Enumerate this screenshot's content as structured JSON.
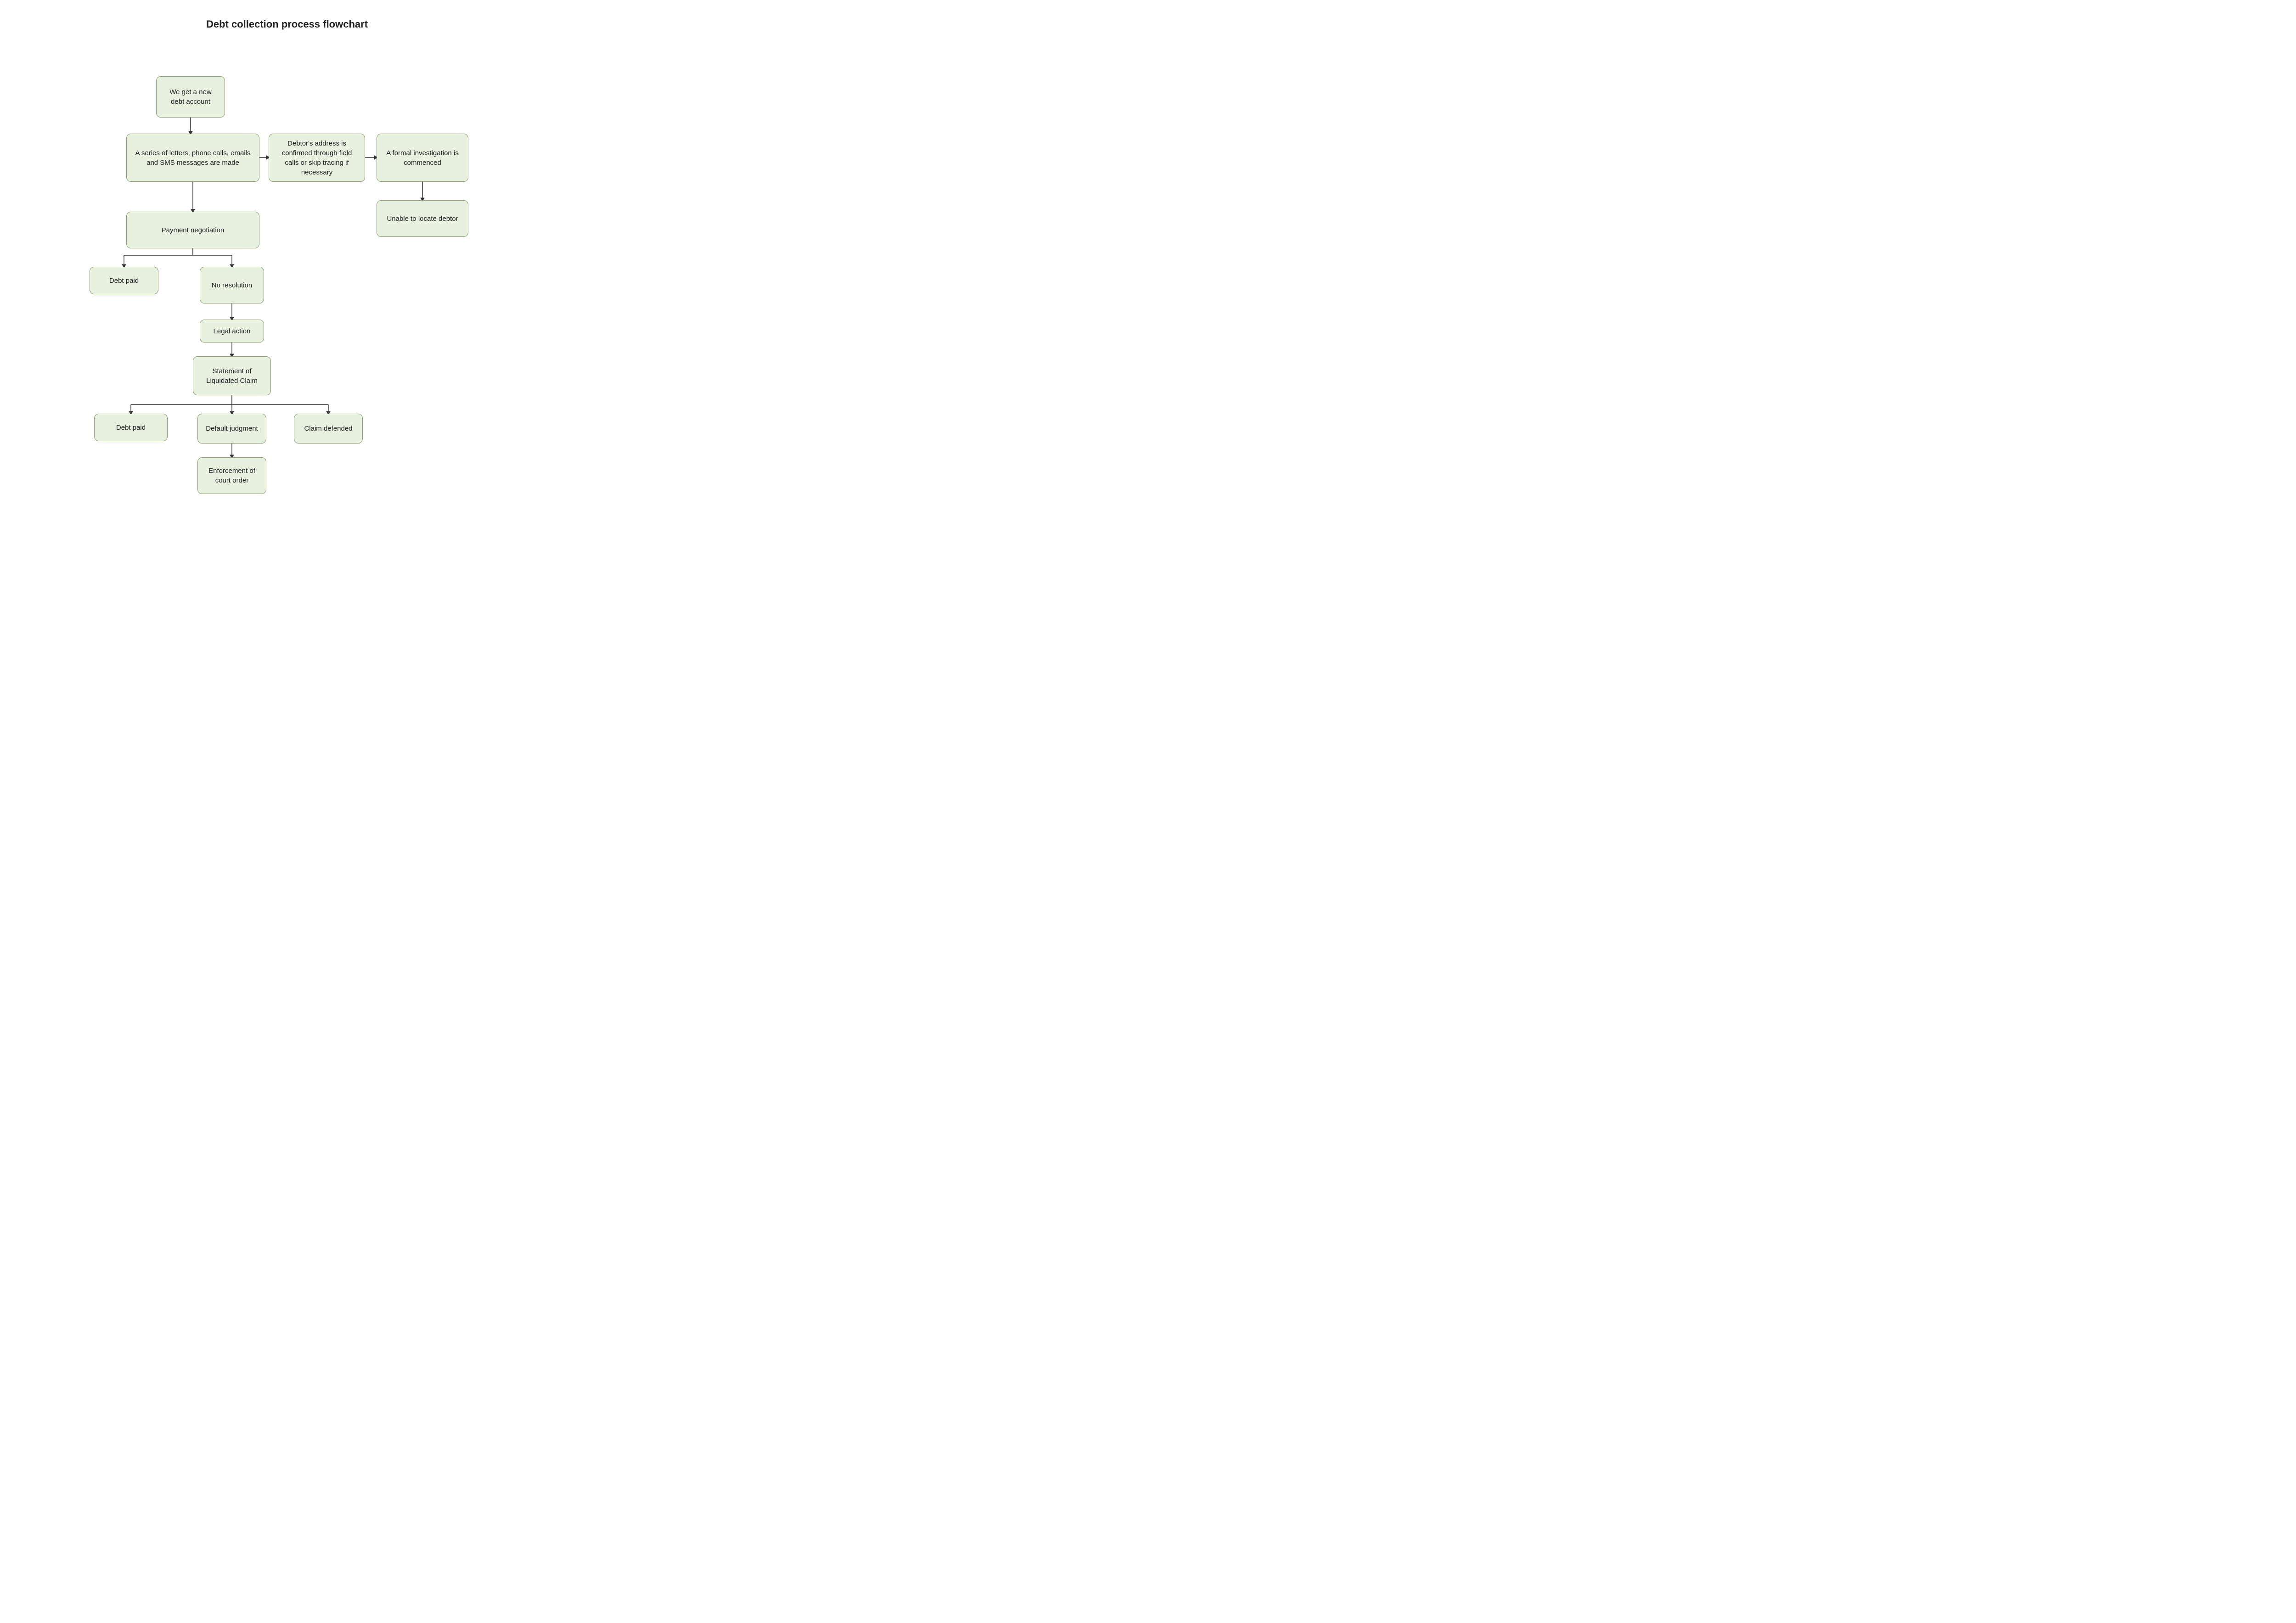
{
  "title": "Debt collection process flowchart",
  "nodes": {
    "new_debt": "We get a new debt account",
    "letters": "A series of letters, phone calls, emails and SMS messages are made",
    "address_confirm": "Debtor's address is confirmed through field calls or skip tracing if necessary",
    "formal_investigation": "A formal investigation is commenced",
    "payment_negotiation": "Payment negotiation",
    "unable_to_locate": "Unable to locate debtor",
    "debt_paid_1": "Debt paid",
    "no_resolution": "No resolution",
    "legal_action": "Legal action",
    "statement": "Statement of Liquidated Claim",
    "debt_paid_2": "Debt paid",
    "default_judgment": "Default judgment",
    "claim_defended": "Claim defended",
    "enforcement": "Enforcement of court order"
  }
}
